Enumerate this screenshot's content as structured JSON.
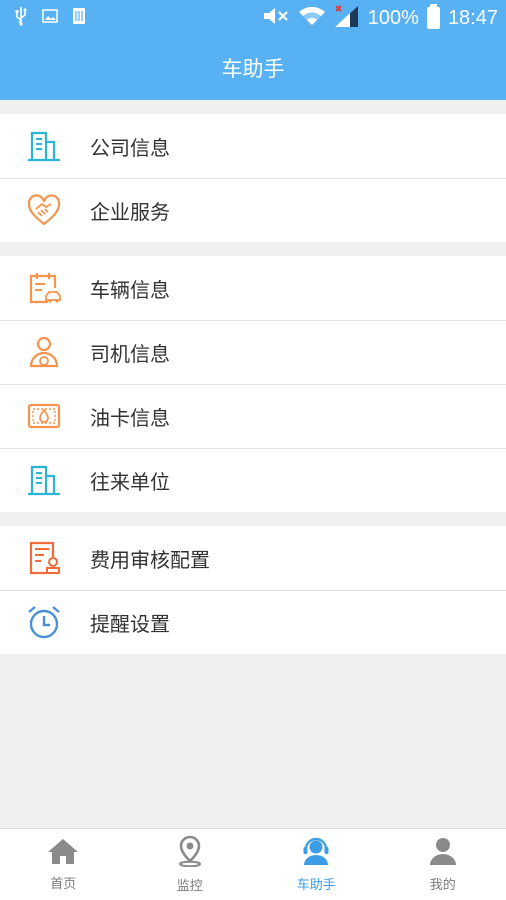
{
  "status_bar": {
    "battery": "100%",
    "time": "18:47",
    "icons": [
      "usb-icon",
      "image-icon",
      "sim-icon",
      "mute-icon",
      "wifi-icon",
      "signal-icon",
      "battery-icon"
    ]
  },
  "header": {
    "title": "车助手"
  },
  "colors": {
    "primary": "#57b1f3",
    "cyan_icon": "#2bb5d6",
    "orange_icon": "#f6934c",
    "blue_icon": "#4a90d9",
    "tab_inactive": "#9a9a9a",
    "tab_active": "#3d9de6"
  },
  "menu": {
    "group1": [
      {
        "label": "公司信息",
        "icon": "building-icon"
      },
      {
        "label": "企业服务",
        "icon": "handshake-heart-icon"
      }
    ],
    "group2": [
      {
        "label": "车辆信息",
        "icon": "vehicle-calendar-icon"
      },
      {
        "label": "司机信息",
        "icon": "driver-icon"
      },
      {
        "label": "油卡信息",
        "icon": "fuel-card-icon"
      },
      {
        "label": "往来单位",
        "icon": "building-icon"
      }
    ],
    "group3": [
      {
        "label": "费用审核配置",
        "icon": "expense-audit-icon"
      },
      {
        "label": "提醒设置",
        "icon": "alarm-clock-icon"
      }
    ]
  },
  "tabs": [
    {
      "label": "首页",
      "icon": "home-icon",
      "active": false
    },
    {
      "label": "监控",
      "icon": "location-pin-icon",
      "active": false
    },
    {
      "label": "车助手",
      "icon": "customer-service-icon",
      "active": true
    },
    {
      "label": "我的",
      "icon": "user-icon",
      "active": false
    }
  ]
}
